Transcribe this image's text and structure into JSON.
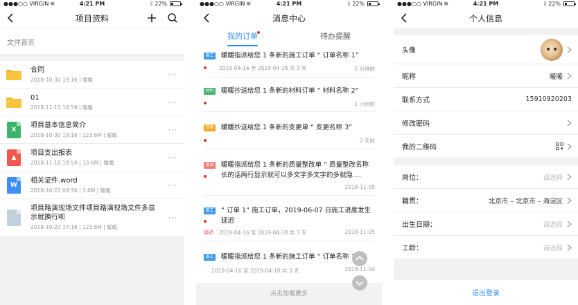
{
  "status_bar": {
    "carrier": "●●●○○ VIRGIN",
    "time": "4:21 PM",
    "battery": "22%"
  },
  "screen1": {
    "title": "项目资料",
    "breadcrumb": "文件首页",
    "more_label": "···",
    "files": [
      {
        "name": "合同",
        "meta": "2018-10-30 19:16 | 暖暖",
        "type": "folder"
      },
      {
        "name": "01",
        "meta": "2018-11-10 18:59 | 暖暖",
        "type": "folder"
      },
      {
        "name": "项目基本信息简介",
        "meta": "2018-10-30 19:16 | 123.6M | 暖暖",
        "type": "excel"
      },
      {
        "name": "项目支出报表",
        "meta": "2018-11-10 18:59 | 13.6M | 暖暖",
        "type": "image"
      },
      {
        "name": "相关证件.word",
        "meta": "2018-10-22 09:36 | 3.6M | 暖暖",
        "type": "word"
      },
      {
        "name": "项目路演现场文件项目路演现场文件多显示就换行呗",
        "meta": "2018-10-20 17:16 | 123.6M | 暖暖",
        "type": "generic"
      }
    ]
  },
  "screen2": {
    "title": "消息中心",
    "tabs": [
      {
        "label": "我的订单"
      },
      {
        "label": "待办提醒"
      }
    ],
    "messages": [
      {
        "tag": "施工",
        "text": "暖暖指派给您 1 条新的施工订单 “ 订单名称 1”",
        "sub": "2019-04-16 至 2019-04-18 共 3 天",
        "right": "5 分钟前"
      },
      {
        "tag": "材料",
        "text": "暖暖抄送给您 1 条新的材料订单 “ 材料名称 2”",
        "sub": "",
        "right": "1 小时前"
      },
      {
        "tag": "变更",
        "text": "暖暖抄送给您 1 条新的变更单 “ 变更名称 3”",
        "sub": "",
        "right": "2 天前"
      },
      {
        "tag": "整改",
        "text": "暖暖指派给您 1 条新的质量整改单 “ 质量整改名称长的话两行显示就可以多文字多文字的多就隐 ...",
        "sub": "",
        "right": "2018-11-05"
      },
      {
        "tag": "施工",
        "text": "“ 订单 1” 施工订单，2019-06-07 日施工进度发生延迟",
        "sub": "2019-04-16 至 2019-04-18 共 3 天",
        "right": "2018-11-05",
        "delay": "延迟"
      },
      {
        "tag": "施工",
        "text": "暖暖指派给您 1 条新的施工订单 “ 订单名称 1”",
        "sub": "2019-04-16 至 2019-04-18 共 3 天",
        "right": "2018-11-04"
      }
    ],
    "load_more": "点击加载更多"
  },
  "screen3": {
    "title": "个人信息",
    "rows": [
      {
        "label": "头像",
        "value": ""
      },
      {
        "label": "昵称",
        "value": "暖暖"
      },
      {
        "label": "联系方式",
        "value": "15910920203"
      },
      {
        "label": "修改密码",
        "value": ""
      },
      {
        "label": "我的二维码",
        "value": ""
      }
    ],
    "rows2": [
      {
        "label": "岗位：",
        "value": "请选择"
      },
      {
        "label": "籍贯：",
        "value": "北京市 – 北京市 – 海淀区"
      },
      {
        "label": "出生日期：",
        "value": "请选择"
      },
      {
        "label": "工龄：",
        "value": "请选择"
      }
    ],
    "logout": "退出登录"
  },
  "colors": {
    "accent": "#2d8cf0",
    "red": "#e0302b",
    "folder": "#f5b927",
    "excel": "#3bb36a",
    "image": "#f0574e",
    "word": "#3e8ef5",
    "generic": "#c2cfdc",
    "tag_blue": "#3d9be9",
    "tag_green": "#47b26b",
    "tag_orange": "#f5a623",
    "tag_red": "#ef7a7a"
  }
}
